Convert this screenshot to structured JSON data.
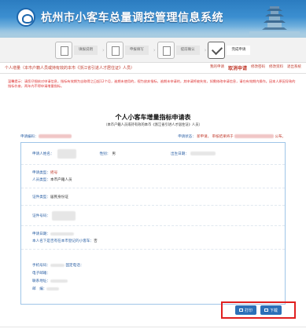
{
  "header": {
    "site_title": "杭州市小客车总量调控管理信息系统"
  },
  "steps": [
    {
      "label": "填报说明",
      "icon": "document-icon"
    },
    {
      "label": "申报填写",
      "icon": "edit-icon"
    },
    {
      "label": "提前确认",
      "icon": "document-icon"
    },
    {
      "label": "完成申请",
      "icon": "check-icon"
    }
  ],
  "nav": {
    "user": "个人增量（本市户籍人员或持有效的本市《浙江省引进人才居住证》人员）",
    "links": [
      "我的申请",
      "取消申请",
      "修改密码",
      "修改资料",
      "退出系统"
    ]
  },
  "notice": "温馨提示：请您仔细核对申请信息，指标有效期为自取得之日起12个月，逾期未使用的，视为放弃指标，逾期未申请的，其申请将被失效，如需修改申请信息，请在有效期内操作。因本人原因导致的指标作废，两年内不得申请增量指标。",
  "form": {
    "title": "个人小客车增量指标申请表",
    "subtitle": "（本市户籍人员或持有效的本市《浙江省引进人才居住证》人员）",
    "app_no_label": "申请编码：",
    "status_label": "申请状态：",
    "status_value": "新申请，",
    "status_tail": "审核结果将于",
    "status_end": "公布。",
    "fields": {
      "applicant_name": "申请人姓名：",
      "gender_label": "性别：",
      "gender_value": "男",
      "birth_label": "出生日期：",
      "person_type_label": "申请类型：",
      "person_type_value": "摇号",
      "person_cat_label": "人员类型：",
      "person_cat_value": "本市户籍人员",
      "id_type_label": "证件类型：",
      "id_type_value": "居民身份证",
      "id_no_label": "证件号码：",
      "apply_date_label": "申请日期：",
      "owner_label": "本人名下是否有在本市登记的小客车：",
      "owner_value": "否",
      "phone_label": "手机号码：",
      "fixed_phone_label": "固定电话：",
      "email_label": "电子邮箱：",
      "address_label": "联系地址：",
      "postcode_label": "邮　编："
    }
  },
  "buttons": {
    "print": "打印",
    "download": "下载"
  }
}
